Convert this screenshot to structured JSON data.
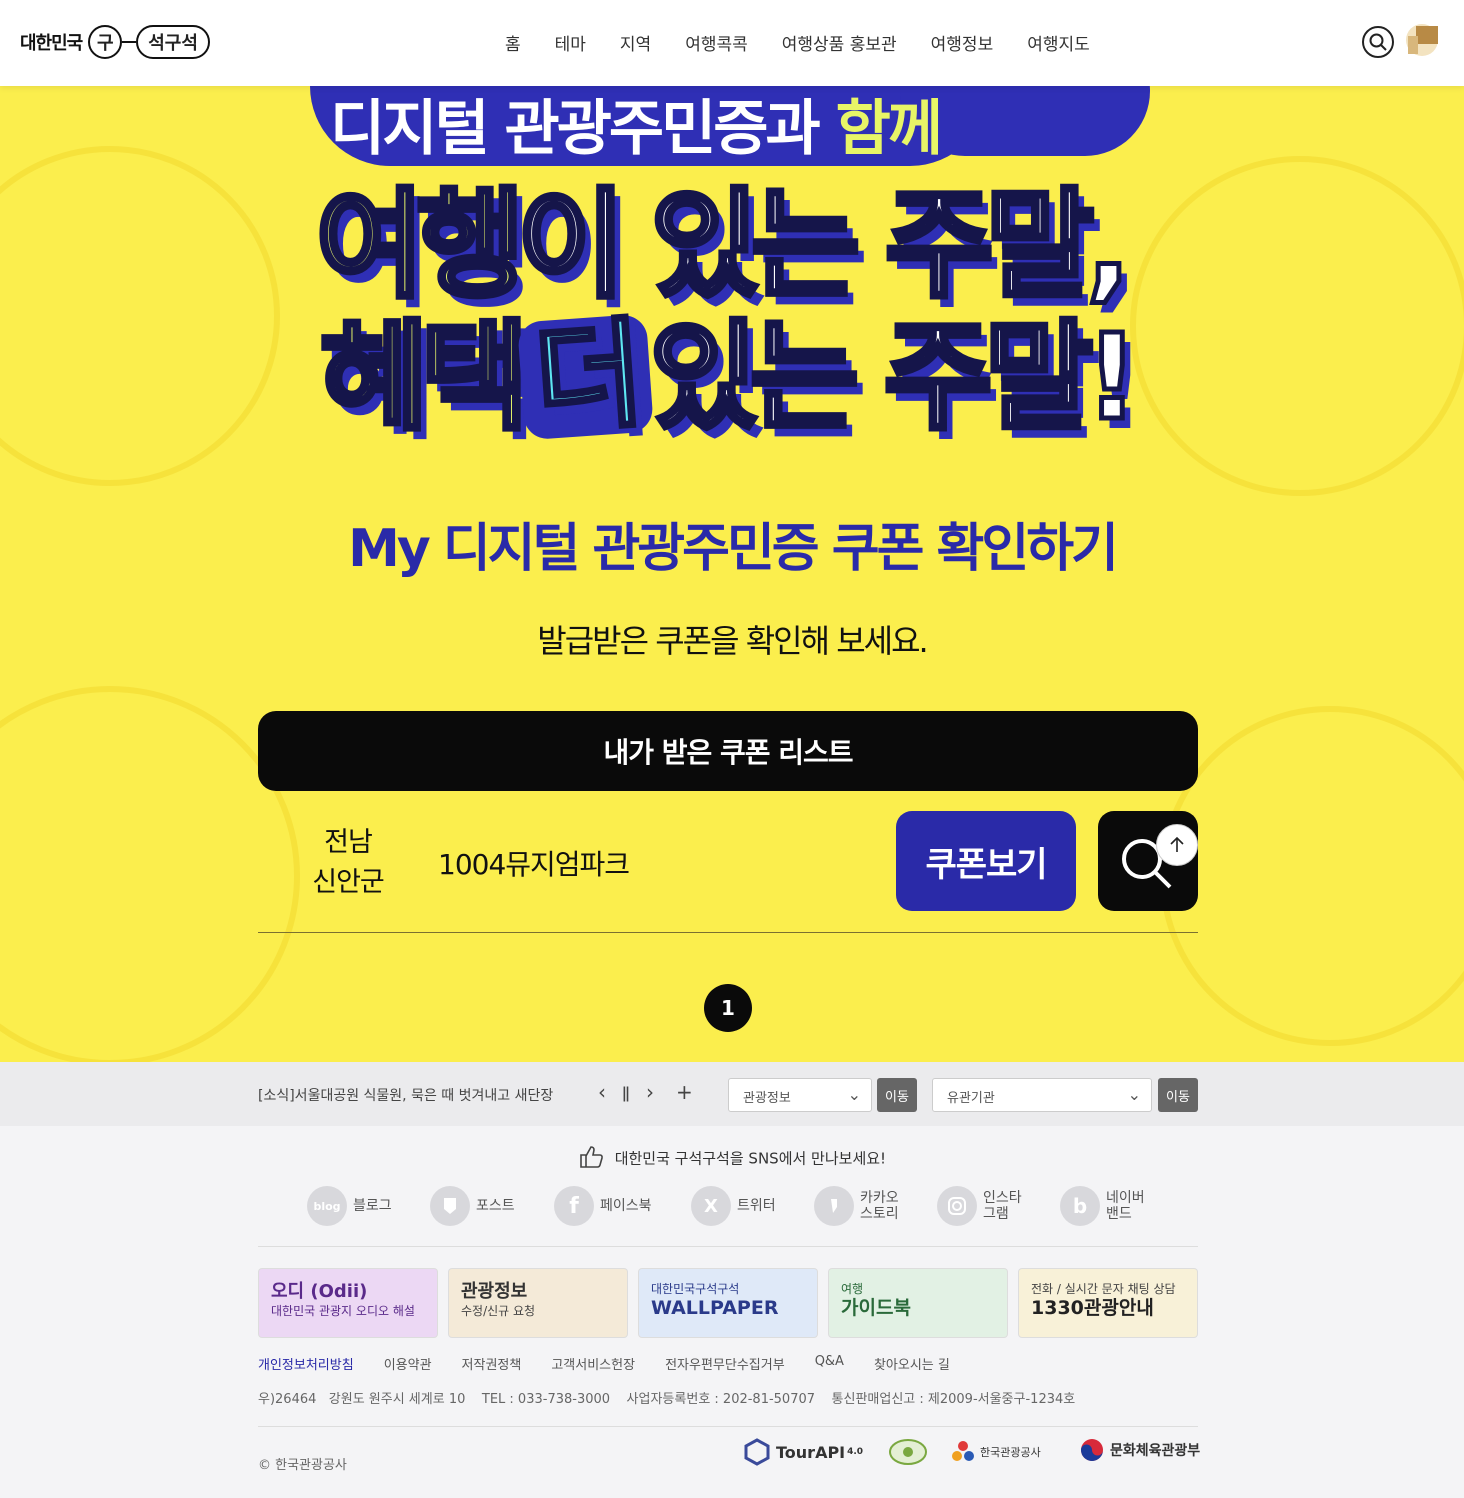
{
  "header": {
    "logo_text": "대한민국",
    "logo_circle": "구",
    "logo_pill": "석구석",
    "nav": [
      "홈",
      "테마",
      "지역",
      "여행콕콕",
      "여행상품 홍보관",
      "여행정보",
      "여행지도"
    ]
  },
  "hero": {
    "banner_top_main": "디지털 관광주민증과",
    "banner_top_highlight": "함께",
    "headline1_lime": "여행",
    "headline1_rest": "이 있는 주말,",
    "headline2_lime": "혜택",
    "headline2_badge": "더",
    "headline2_rest": "있는 주말!",
    "sub_title": "My 디지털 관광주민증 쿠폰 확인하기",
    "description": "발급받은 쿠폰을 확인해 보세요.",
    "list_button": "내가 받은 쿠폰 리스트",
    "coupons": [
      {
        "region_line1": "전남",
        "region_line2": "신안군",
        "place": "1004뮤지엄파크",
        "button": "쿠폰보기"
      }
    ],
    "pagination": {
      "current": "1"
    }
  },
  "newsbar": {
    "headline": "[소식]서울대공원 식물원, 묵은 때 벗겨내고 새단장",
    "prev": "‹",
    "pause": "ǁ",
    "next": "›",
    "plus": "+",
    "select1": "관광정보",
    "select2": "유관기관",
    "go_label": "이동"
  },
  "footer": {
    "sns_title": "대한민국 구석구석을 SNS에서 만나보세요!",
    "sns": [
      {
        "icon": "blog",
        "label1": "블로그",
        "label2": ""
      },
      {
        "icon": "",
        "label1": "포스트",
        "label2": ""
      },
      {
        "icon": "f",
        "label1": "페이스북",
        "label2": ""
      },
      {
        "icon": "X",
        "label1": "트위터",
        "label2": ""
      },
      {
        "icon": "",
        "label1": "카카오",
        "label2": "스토리"
      },
      {
        "icon": "",
        "label1": "인스타",
        "label2": "그램"
      },
      {
        "icon": "b",
        "label1": "네이버",
        "label2": "밴드"
      }
    ],
    "banners": [
      {
        "line1": "오디 (Odii)",
        "line2": "대한민국 관광지 오디오 해설"
      },
      {
        "line1": "관광정보",
        "line2": "수정/신규 요청"
      },
      {
        "line1": "대한민국구석구석",
        "line2": "WALLPAPER"
      },
      {
        "line1": "여행",
        "line2": "가이드북"
      },
      {
        "line1": "전화 / 실시간 문자 채팅 상담",
        "line2": "1330관광안내"
      }
    ],
    "links": [
      "개인정보처리방침",
      "이용약관",
      "저작권정책",
      "고객서비스헌장",
      "전자우편무단수집거부",
      "Q&A",
      "찾아오시는 길"
    ],
    "address": "우)26464   강원도 원주시 세계로 10    TEL : 033-738-3000    사업자등록번호 : 202-81-50707    통신판매업신고 : 제2009-서울중구-1234호",
    "copyright": "© 한국관광공사",
    "partners": [
      "TourAPI",
      "4.0",
      "한국관광공사",
      "문화체육관광부"
    ]
  },
  "colors": {
    "hero_bg": "#fbee4d",
    "brand_blue": "#2a2aa8",
    "lime": "#e6f56a",
    "cyan": "#5ee6f2"
  }
}
